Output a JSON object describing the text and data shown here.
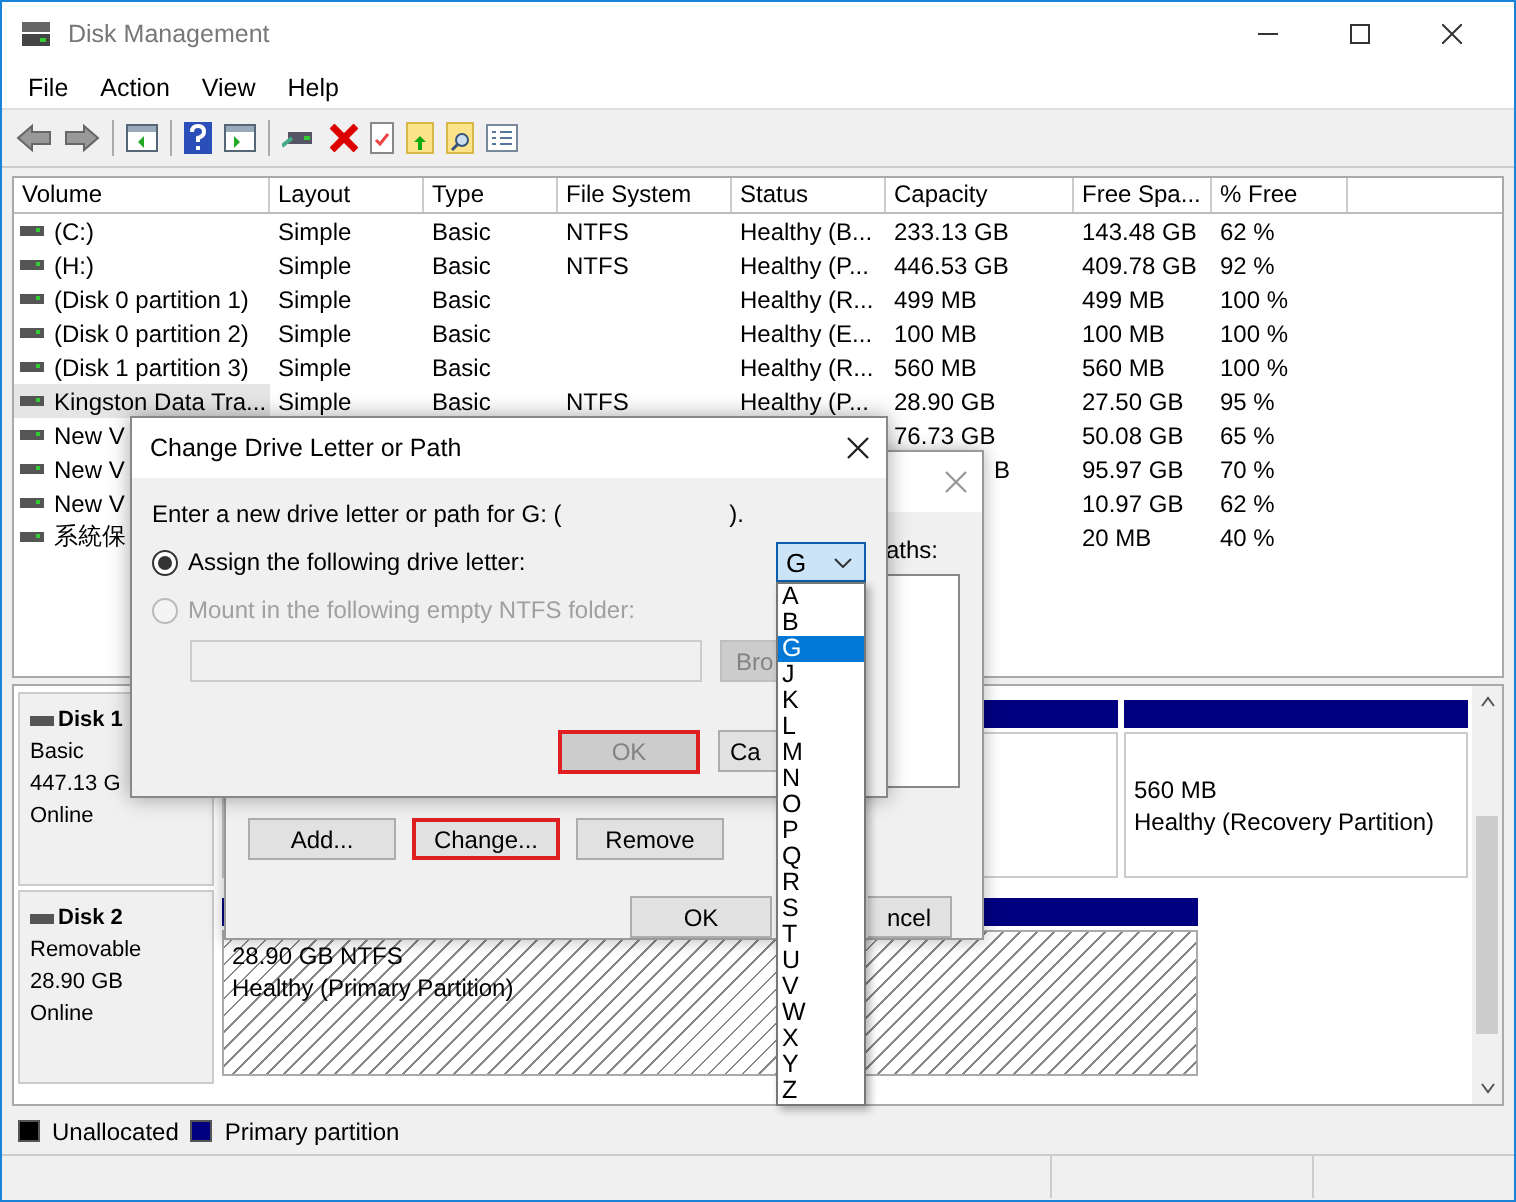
{
  "window": {
    "title": "Disk Management"
  },
  "menu": [
    "File",
    "Action",
    "View",
    "Help"
  ],
  "volumes": {
    "columns": [
      "Volume",
      "Layout",
      "Type",
      "File System",
      "Status",
      "Capacity",
      "Free Spa...",
      "% Free"
    ],
    "rows": [
      {
        "cells": [
          "(C:)",
          "Simple",
          "Basic",
          "NTFS",
          "Healthy (B...",
          "233.13 GB",
          "143.48 GB",
          "62 %"
        ],
        "selected": false
      },
      {
        "cells": [
          "(H:)",
          "Simple",
          "Basic",
          "NTFS",
          "Healthy (P...",
          "446.53 GB",
          "409.78 GB",
          "92 %"
        ],
        "selected": false
      },
      {
        "cells": [
          "(Disk 0 partition 1)",
          "Simple",
          "Basic",
          "",
          "Healthy (R...",
          "499 MB",
          "499 MB",
          "100 %"
        ],
        "selected": false
      },
      {
        "cells": [
          "(Disk 0 partition 2)",
          "Simple",
          "Basic",
          "",
          "Healthy (E...",
          "100 MB",
          "100 MB",
          "100 %"
        ],
        "selected": false
      },
      {
        "cells": [
          "(Disk 1 partition 3)",
          "Simple",
          "Basic",
          "",
          "Healthy (R...",
          "560 MB",
          "560 MB",
          "100 %"
        ],
        "selected": false
      },
      {
        "cells": [
          "Kingston Data Tra...",
          "Simple",
          "Basic",
          "NTFS",
          "Healthy (P...",
          "28.90 GB",
          "27.50 GB",
          "95 %"
        ],
        "selected": true
      },
      {
        "cells": [
          "New V",
          "",
          "",
          "",
          "",
          "76.73 GB",
          "50.08 GB",
          "65 %"
        ],
        "selected": false
      },
      {
        "cells": [
          "New V",
          "",
          "",
          "",
          "",
          "B",
          "95.97 GB",
          "70 %"
        ],
        "selected": false
      },
      {
        "cells": [
          "New V",
          "",
          "",
          "",
          "",
          "",
          "10.97 GB",
          "62 %"
        ],
        "selected": false
      },
      {
        "cells": [
          "系統保",
          "",
          "",
          "",
          "",
          "",
          "20 MB",
          "40 %"
        ],
        "selected": false
      }
    ]
  },
  "disks": [
    {
      "name": "Disk 1",
      "type": "Basic",
      "size": "447.13 G",
      "status": "Online",
      "partitions": [
        {
          "selected": false
        },
        {
          "lines": [
            "560 MB",
            "Healthy (Recovery Partition)"
          ],
          "selected": false
        }
      ]
    },
    {
      "name": "Disk 2",
      "type": "Removable",
      "size": "28.90 GB",
      "status": "Online",
      "partitions": [
        {
          "lines": [
            "28.90 GB NTFS",
            "Healthy (Primary Partition)"
          ],
          "selected": true
        }
      ]
    }
  ],
  "legend": [
    {
      "label": "Unallocated",
      "color": "#000000"
    },
    {
      "label": "Primary partition",
      "color": "#000080"
    }
  ],
  "properties_dialog": {
    "paths_label": "aths:",
    "buttons": [
      {
        "label": "Add...",
        "highlighted": false
      },
      {
        "label": "Change...",
        "highlighted": true
      },
      {
        "label": "Remove",
        "highlighted": false
      }
    ],
    "ok": "OK",
    "cancel": "ncel"
  },
  "change_dialog": {
    "title": "Change Drive Letter or Path",
    "prompt": "Enter a new drive letter or path for G: (",
    "prompt_end": ").",
    "options": [
      {
        "label": "Assign the following drive letter:",
        "selected": true,
        "disabled": false
      },
      {
        "label": "Mount in the following empty NTFS folder:",
        "selected": false,
        "disabled": true
      }
    ],
    "browse": "Bro",
    "ok": {
      "label": "OK",
      "disabled": true,
      "highlighted": true
    },
    "cancel": "Ca",
    "drive_letter": {
      "value": "G",
      "options": [
        {
          "label": "A",
          "selected": false
        },
        {
          "label": "B",
          "selected": false
        },
        {
          "label": "G",
          "selected": true
        },
        {
          "label": "J",
          "selected": false
        },
        {
          "label": "K",
          "selected": false
        },
        {
          "label": "L",
          "selected": false
        },
        {
          "label": "M",
          "selected": false
        },
        {
          "label": "N",
          "selected": false
        },
        {
          "label": "O",
          "selected": false
        },
        {
          "label": "P",
          "selected": false
        },
        {
          "label": "Q",
          "selected": false
        },
        {
          "label": "R",
          "selected": false
        },
        {
          "label": "S",
          "selected": false
        },
        {
          "label": "T",
          "selected": false
        },
        {
          "label": "U",
          "selected": false
        },
        {
          "label": "V",
          "selected": false
        },
        {
          "label": "W",
          "selected": false
        },
        {
          "label": "X",
          "selected": false
        },
        {
          "label": "Y",
          "selected": false
        },
        {
          "label": "Z",
          "selected": false
        }
      ]
    }
  }
}
